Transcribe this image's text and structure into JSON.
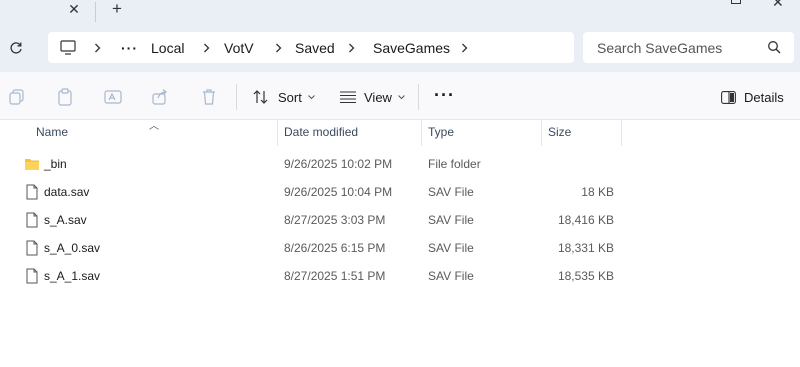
{
  "address": {
    "crumbs": [
      "Local",
      "VotV",
      "Saved",
      "SaveGames"
    ]
  },
  "search": {
    "placeholder": "Search SaveGames"
  },
  "toolbar": {
    "sort_label": "Sort",
    "view_label": "View",
    "details_label": "Details"
  },
  "columns": {
    "name": "Name",
    "date": "Date modified",
    "type": "Type",
    "size": "Size"
  },
  "files": [
    {
      "name": "_bin",
      "date": "9/26/2025 10:02 PM",
      "type": "File folder",
      "size": "",
      "icon": "folder-icon"
    },
    {
      "name": "data.sav",
      "date": "9/26/2025 10:04 PM",
      "type": "SAV File",
      "size": "18 KB",
      "icon": "file-icon"
    },
    {
      "name": "s_A.sav",
      "date": "8/27/2025 3:03 PM",
      "type": "SAV File",
      "size": "18,416 KB",
      "icon": "file-icon"
    },
    {
      "name": "s_A_0.sav",
      "date": "8/26/2025 6:15 PM",
      "type": "SAV File",
      "size": "18,331 KB",
      "icon": "file-icon"
    },
    {
      "name": "s_A_1.sav",
      "date": "8/27/2025 1:51 PM",
      "type": "SAV File",
      "size": "18,535 KB",
      "icon": "file-icon"
    }
  ]
}
